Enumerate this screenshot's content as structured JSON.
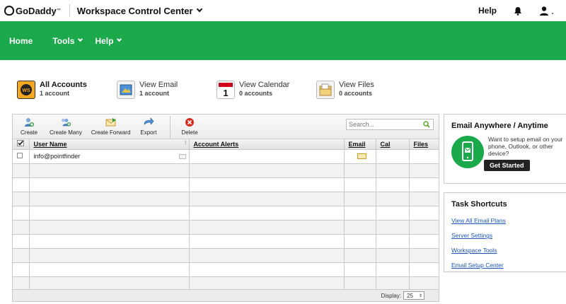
{
  "topbar": {
    "logo_text": "GoDaddy",
    "logo_tm": "™",
    "app_title": "Workspace Control Center",
    "help_label": "Help"
  },
  "nav": {
    "items": [
      {
        "label": "Home"
      },
      {
        "label": "Tools"
      },
      {
        "label": "Help"
      }
    ]
  },
  "tiles": [
    {
      "title": "All Accounts",
      "sub": "1 account",
      "icon": "all-accounts-icon"
    },
    {
      "title": "View Email",
      "sub": "1 account",
      "icon": "email-icon"
    },
    {
      "title": "View Calendar",
      "sub": "0 accounts",
      "icon": "calendar-icon",
      "calendar_day": "1"
    },
    {
      "title": "View Files",
      "sub": "0 accounts",
      "icon": "files-icon"
    }
  ],
  "toolbar": {
    "create": "Create",
    "create_many": "Create Many",
    "create_forward": "Create Forward",
    "export": "Export",
    "delete": "Delete",
    "search_placeholder": "Search..."
  },
  "table": {
    "headers": {
      "user_name": "User Name",
      "account_alerts": "Account Alerts",
      "email": "Email",
      "cal": "Cal",
      "files": "Files"
    },
    "rows": [
      {
        "user_name": "info@pointfinder"
      }
    ]
  },
  "footer": {
    "display_label": "Display:",
    "display_value": "25"
  },
  "promo": {
    "title": "Email Anywhere / Anytime",
    "text": "Want to setup email on your phone, Outlook, or other device?",
    "button": "Get Started"
  },
  "shortcuts": {
    "title": "Task Shortcuts",
    "links": [
      "View All Email Plans",
      "Server Settings",
      "Workspace Tools",
      "Email Setup Center"
    ]
  },
  "colors": {
    "brand_green": "#1ba94c",
    "link_blue": "#1a56b8"
  }
}
